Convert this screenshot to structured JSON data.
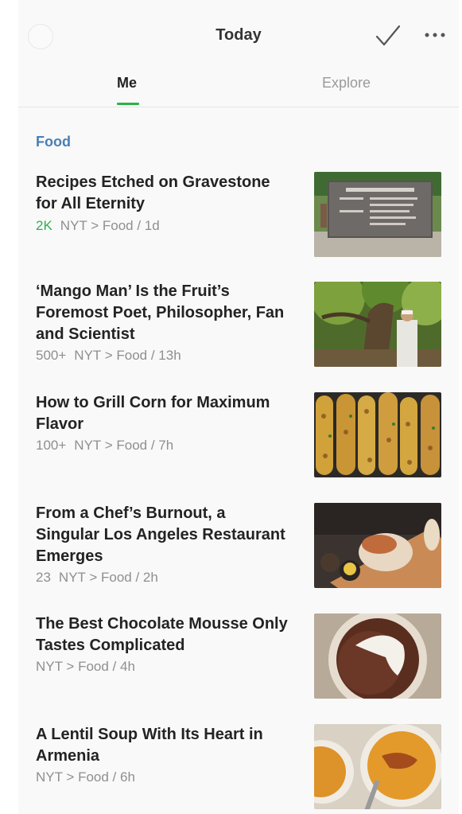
{
  "header": {
    "title": "Today"
  },
  "tabs": [
    {
      "label": "Me",
      "active": true
    },
    {
      "label": "Explore",
      "active": false
    }
  ],
  "section": {
    "label": "Food"
  },
  "articles": [
    {
      "title": "Recipes Etched on Gravestone for All Eternity",
      "count": "2K",
      "count_highlight": true,
      "source": "NYT > Food / 1d",
      "thumbnail": "gravestone-photo"
    },
    {
      "title": "‘Mango Man’ Is the Fruit’s Foremost Poet, Philosopher, Fan and Scientist",
      "count": "500+",
      "count_highlight": false,
      "source": "NYT > Food / 13h",
      "thumbnail": "mango-man-photo"
    },
    {
      "title": "How to Grill Corn for Maximum Flavor",
      "count": "100+",
      "count_highlight": false,
      "source": "NYT > Food / 7h",
      "thumbnail": "grilled-corn-photo"
    },
    {
      "title": "From a Chef’s Burnout, a Singular Los Angeles Restaurant Emerges",
      "count": "23",
      "count_highlight": false,
      "source": "NYT > Food / 2h",
      "thumbnail": "restaurant-dish-photo"
    },
    {
      "title": "The Best Chocolate Mousse Only Tastes Complicated",
      "count": "",
      "count_highlight": false,
      "source": "NYT > Food / 4h",
      "thumbnail": "chocolate-mousse-photo"
    },
    {
      "title": "A Lentil Soup With Its Heart in Armenia",
      "count": "",
      "count_highlight": false,
      "source": "NYT > Food / 6h",
      "thumbnail": "lentil-soup-photo"
    }
  ],
  "colors": {
    "accent_green": "#2bb24c",
    "section_blue": "#4a7fb4",
    "meta_gray": "#8f8f8f"
  }
}
